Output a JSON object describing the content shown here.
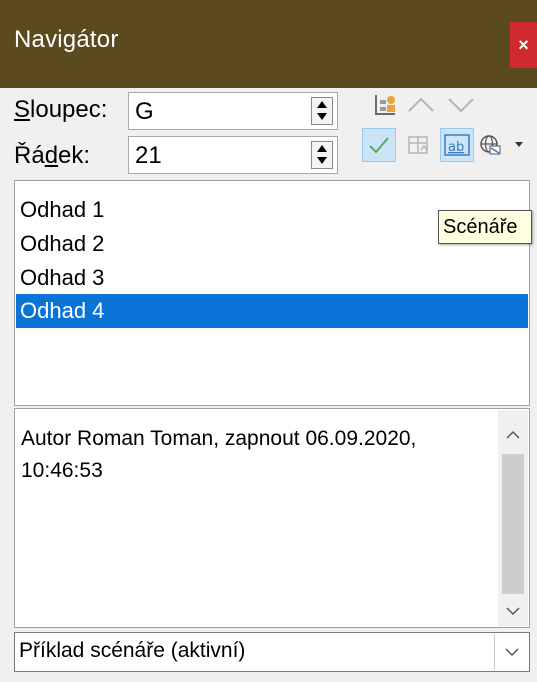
{
  "window": {
    "title": "Navigátor",
    "close_label": "×"
  },
  "fields": {
    "column": {
      "label": "Sloupec:",
      "mnemonic": "S",
      "value": "G"
    },
    "row": {
      "label": "Řádek:",
      "mnemonic": "d",
      "value": "21"
    }
  },
  "toolbar": {
    "icons": [
      "content-view-icon",
      "previous-icon",
      "next-icon",
      "data-range-icon",
      "drag-mode-icon",
      "scenarios-icon",
      "document-selector-icon"
    ],
    "active": "scenarios-icon"
  },
  "tooltip": "Scénáře",
  "scenarios": {
    "items": [
      "Odhad 1",
      "Odhad 2",
      "Odhad 3",
      "Odhad 4"
    ],
    "selected_index": 3
  },
  "comment": "Autor Roman Toman, zapnout 06.09.2020, 10:46:53",
  "document_select": {
    "value": "Příklad scénáře (aktivní)"
  },
  "colors": {
    "titlebar": "#5b4a1e",
    "selection": "#0a74d6",
    "close": "#d0292f"
  }
}
